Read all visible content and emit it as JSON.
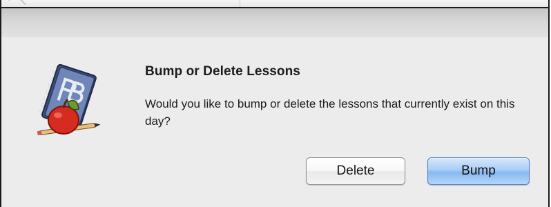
{
  "dialog": {
    "title": "Bump or Delete Lessons",
    "message": "Would you like to bump or delete the lessons that currently exist on this day?",
    "icon": "planbook-app-icon",
    "buttons": {
      "delete_label": "Delete",
      "bump_label": "Bump"
    },
    "default_button_color": "#9fc6f5"
  }
}
